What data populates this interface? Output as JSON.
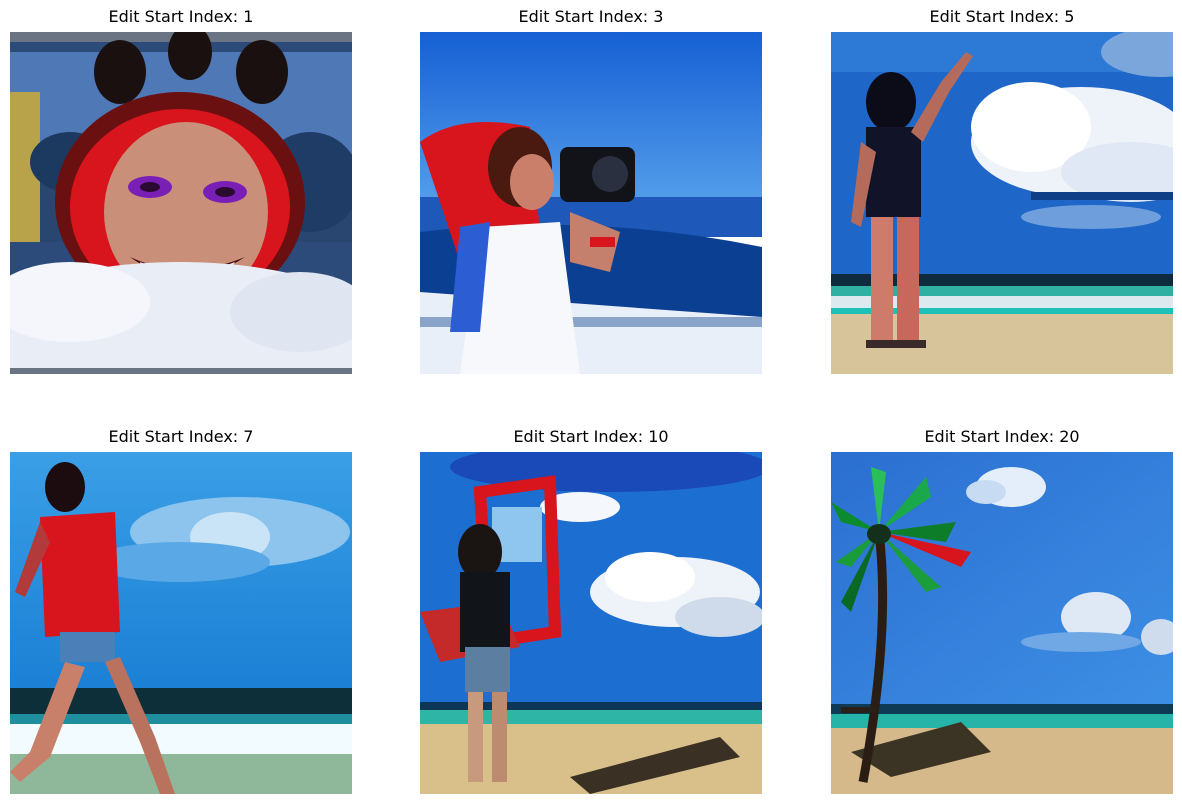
{
  "figure": {
    "panels": [
      {
        "title": "Edit Start Index: 1",
        "scene": "smiling-woman-with-ear-headband"
      },
      {
        "title": "Edit Start Index: 3",
        "scene": "woman-with-camera-by-sea"
      },
      {
        "title": "Edit Start Index: 5",
        "scene": "woman-waving-on-beach"
      },
      {
        "title": "Edit Start Index: 7",
        "scene": "woman-running-on-beach"
      },
      {
        "title": "Edit Start Index: 10",
        "scene": "woman-holding-frame-on-beach"
      },
      {
        "title": "Edit Start Index: 20",
        "scene": "palm-tree-on-beach"
      }
    ]
  },
  "colors": {
    "sky_blue": "#1f6fd1",
    "sky_light": "#4aa6ea",
    "sea_dark": "#0a3f8f",
    "sand": "#d8c49a",
    "red_accent": "#d8141c",
    "cloud": "#eef3fa"
  }
}
